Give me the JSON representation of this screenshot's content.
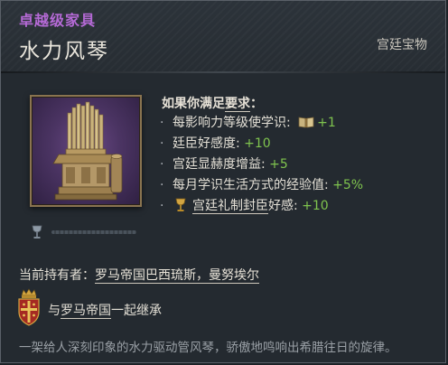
{
  "header": {
    "rarity": "卓越级家具",
    "title": "水力风琴",
    "category": "宫廷宝物"
  },
  "artifact_image": {
    "icon": "hydraulic-organ-artwork"
  },
  "requirements": {
    "prefix": "如果你满足",
    "link": "要求",
    "suffix": "："
  },
  "bullets": [
    {
      "label": "每影响力等级使学识: ",
      "icon": "book-icon",
      "value": "+1"
    },
    {
      "label": "廷臣好感度: ",
      "value": "+10"
    },
    {
      "label": "宫廷显赫度增益: ",
      "value": "+5"
    },
    {
      "label": "每月学识生活方式的经验值: ",
      "value": "+5%"
    },
    {
      "icon": "goblet-icon",
      "link": "宫廷礼制封臣",
      "label": "好感: ",
      "value": "+10"
    }
  ],
  "durability": {
    "icon": "goblet-icon",
    "fraction": 0.0
  },
  "holder": {
    "label": "当前持有者：",
    "name": "罗马帝国巴西琉斯，曼努埃尔"
  },
  "inheritance": {
    "prefix": "与",
    "link": "罗马帝国",
    "suffix": "一起继承",
    "coat_of_arms_icon": "byzantine-coat-of-arms-icon"
  },
  "flavor_text": "一架给人深刻印象的水力驱动管风琴，骄傲地鸣响出希腊往日的旋律。",
  "colors": {
    "rarity": "#b56ad6",
    "positive": "#7fc44e",
    "background": "#242a30"
  }
}
